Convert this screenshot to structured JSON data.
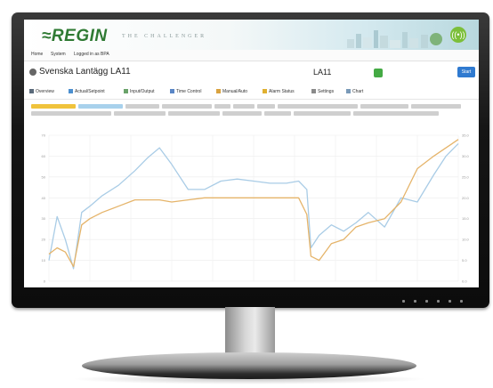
{
  "app": {
    "logo": "≈REGIN",
    "tagline": "THE CHALLENGER"
  },
  "topnav": {
    "items": [
      "Home",
      "System",
      "Logged in as BPA"
    ]
  },
  "header": {
    "title": "Svenska Lantägg LA11",
    "id": "LA11",
    "start_label": "Start"
  },
  "tabs": [
    {
      "label": "Overview",
      "icon": "grid-icon"
    },
    {
      "label": "Actual/Setpoint",
      "icon": "check-icon"
    },
    {
      "label": "Input/Output",
      "icon": "io-icon"
    },
    {
      "label": "Time Control",
      "icon": "calendar-icon"
    },
    {
      "label": "Manual/Auto",
      "icon": "hand-icon"
    },
    {
      "label": "Alarm Status",
      "icon": "alarm-icon"
    },
    {
      "label": "Settings",
      "icon": "gear-icon"
    },
    {
      "label": "Chart",
      "icon": "chart-icon"
    }
  ],
  "colors": {
    "accent": "#2f7ad0",
    "brand": "#2f7a33",
    "status_ok": "#44aa44",
    "series_blue": "#a9cce6",
    "series_orange": "#e5b46a"
  },
  "chart_data": {
    "type": "line",
    "title": "",
    "xlabel": "",
    "ylabel": "",
    "grid": true,
    "y_left_ticks": [
      "70",
      "60",
      "50",
      "40",
      "30",
      "20",
      "10",
      "0"
    ],
    "y_right_ticks": [
      "35.0",
      "30.0",
      "25.0",
      "20.0",
      "15.0",
      "10.0",
      "5.0",
      "0.0"
    ],
    "ylim": [
      0,
      70
    ],
    "x": [
      0,
      2,
      4,
      6,
      8,
      10,
      13,
      17,
      21,
      24,
      27,
      30,
      34,
      38,
      42,
      46,
      50,
      54,
      58,
      61,
      63,
      64,
      66,
      69,
      72,
      75,
      78,
      82,
      86,
      90,
      94,
      97,
      100
    ],
    "series": [
      {
        "values": [
          10,
          31,
          20,
          6,
          33,
          36,
          41,
          46,
          53,
          59,
          64,
          56,
          44,
          44,
          48,
          49,
          48,
          47,
          47,
          48,
          44,
          16,
          22,
          27,
          24,
          28,
          33,
          26,
          40,
          38,
          51,
          60,
          66
        ]
      },
      {
        "values": [
          13,
          16,
          14,
          7,
          27,
          30,
          33,
          36,
          39,
          39,
          39,
          38,
          39,
          40,
          40,
          40,
          40,
          40,
          40,
          40,
          32,
          12,
          10,
          18,
          20,
          26,
          28,
          30,
          38,
          54,
          60,
          64,
          68
        ]
      }
    ]
  }
}
